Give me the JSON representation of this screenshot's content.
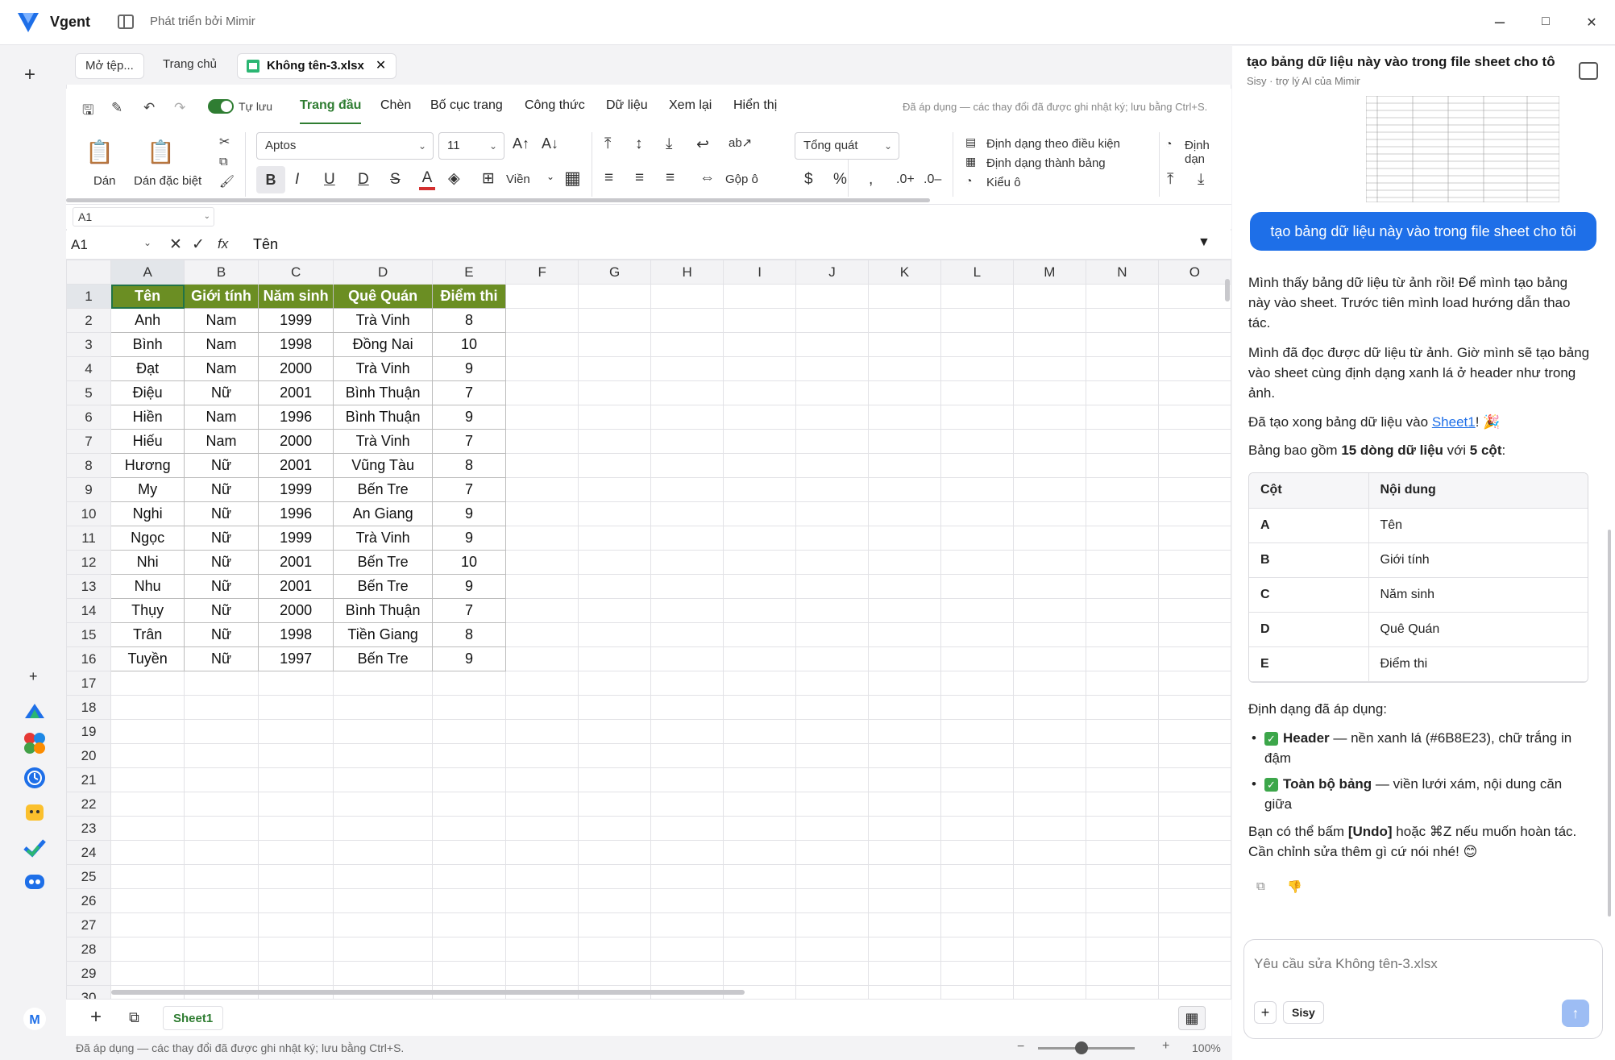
{
  "app": {
    "name": "Vgent",
    "subtitle": "Phát triển bởi Mimir",
    "window_controls": {
      "minimize": "–",
      "maximize": "□",
      "close": "✕"
    }
  },
  "file_tabs": {
    "open_label": "Mở tệp...",
    "home_label": "Trang chủ",
    "active_file": "Không tên-3.xlsx",
    "close_glyph": "✕"
  },
  "ribbon": {
    "autosave_label": "Tự lưu",
    "tabs": [
      "Trang đầu",
      "Chèn",
      "Bố cục trang",
      "Công thức",
      "Dữ liệu",
      "Xem lại",
      "Hiển thị"
    ],
    "notice": "Đã áp dụng — các thay đổi đã được ghi nhật ký; lưu bằng Ctrl+S.",
    "paste_label": "Dán",
    "paste_special_label": "Dán đặc biệt",
    "font_name": "Aptos",
    "font_size": "11",
    "border_label": "Viền",
    "merge_label": "Gộp ô",
    "number_format": "Tổng quát",
    "conditional_format": "Định dạng theo điều kiện",
    "format_as_table": "Định dạng thành bảng",
    "cell_styles": "Kiểu ô",
    "format_cut": "Định dạn",
    "bold": "B",
    "italic": "I",
    "underline": "U",
    "double_underline": "D",
    "strike": "S",
    "font_color_glyph": "A",
    "currency": "$",
    "percent": "%",
    "comma": ",",
    "inc_decimal": ".0+",
    "dec_decimal": ".0–"
  },
  "name_box_top": "A1",
  "formula_bar": {
    "cell_ref": "A1",
    "fx": "fx",
    "value": "Tên"
  },
  "grid": {
    "columns": [
      "A",
      "B",
      "C",
      "D",
      "E",
      "F",
      "G",
      "H",
      "I",
      "J",
      "K",
      "L",
      "M",
      "N",
      "O"
    ],
    "header_row": [
      "Tên",
      "Giới tính",
      "Năm sinh",
      "Quê Quán",
      "Điểm thi"
    ],
    "rows": [
      [
        "Anh",
        "Nam",
        "1999",
        "Trà Vinh",
        "8"
      ],
      [
        "Bình",
        "Nam",
        "1998",
        "Đồng Nai",
        "10"
      ],
      [
        "Đạt",
        "Nam",
        "2000",
        "Trà Vinh",
        "9"
      ],
      [
        "Điệu",
        "Nữ",
        "2001",
        "Bình Thuận",
        "7"
      ],
      [
        "Hiền",
        "Nam",
        "1996",
        "Bình Thuận",
        "9"
      ],
      [
        "Hiếu",
        "Nam",
        "2000",
        "Trà Vinh",
        "7"
      ],
      [
        "Hương",
        "Nữ",
        "2001",
        "Vũng Tàu",
        "8"
      ],
      [
        "My",
        "Nữ",
        "1999",
        "Bến Tre",
        "7"
      ],
      [
        "Nghi",
        "Nữ",
        "1996",
        "An Giang",
        "9"
      ],
      [
        "Ngọc",
        "Nữ",
        "1999",
        "Trà Vinh",
        "9"
      ],
      [
        "Nhi",
        "Nữ",
        "2001",
        "Bến Tre",
        "10"
      ],
      [
        "Nhu",
        "Nữ",
        "2001",
        "Bến Tre",
        "9"
      ],
      [
        "Thụy",
        "Nữ",
        "2000",
        "Bình Thuận",
        "7"
      ],
      [
        "Trân",
        "Nữ",
        "1998",
        "Tiền Giang",
        "8"
      ],
      [
        "Tuyền",
        "Nữ",
        "1997",
        "Bến Tre",
        "9"
      ]
    ],
    "row_numbers": [
      "1",
      "2",
      "3",
      "4",
      "5",
      "6",
      "7",
      "8",
      "9",
      "10",
      "11",
      "12",
      "13",
      "14",
      "15",
      "16",
      "17",
      "18",
      "19",
      "20",
      "21",
      "22",
      "23",
      "24",
      "25",
      "26",
      "27",
      "28",
      "29",
      "30"
    ],
    "header_color": "#6B8E23"
  },
  "sheets": {
    "active": "Sheet1"
  },
  "status_bar": {
    "text": "Đã áp dụng — các thay đổi đã được ghi nhật ký; lưu bằng Ctrl+S.",
    "zoom": "100%",
    "zoom_minus": "−",
    "zoom_plus": "+"
  },
  "chat": {
    "title": "tạo bảng dữ liệu này vào trong file sheet cho tô",
    "subtitle": "Sisy · trợ lý AI của Mimir",
    "user_message": "tạo bảng dữ liệu này vào trong file sheet cho tôi",
    "para1": "Mình thấy bảng dữ liệu từ ảnh rồi! Để mình tạo bảng này vào sheet. Trước tiên mình load hướng dẫn thao tác.",
    "para2": "Mình đã đọc được dữ liệu từ ảnh. Giờ mình sẽ tạo bảng vào sheet cùng định dạng xanh lá ở header như trong ảnh.",
    "para3_prefix": "Đã tạo xong bảng dữ liệu vào ",
    "para3_link": "Sheet1",
    "para3_suffix": "! 🎉",
    "para4_prefix": "Bảng bao gồm ",
    "para4_bold1": "15 dòng dữ liệu",
    "para4_mid": " với ",
    "para4_bold2": "5 cột",
    "para4_suffix": ":",
    "table_headers": [
      "Cột",
      "Nội dung"
    ],
    "table_rows": [
      [
        "A",
        "Tên"
      ],
      [
        "B",
        "Giới tính"
      ],
      [
        "C",
        "Năm sinh"
      ],
      [
        "D",
        "Quê Quán"
      ],
      [
        "E",
        "Điểm thi"
      ]
    ],
    "format_heading": "Định dạng đã áp dụng:",
    "bullet1_bold": "Header",
    "bullet1_text": " — nền xanh lá (#6B8E23), chữ trắng in đậm",
    "bullet2_bold": "Toàn bộ bảng",
    "bullet2_text": " — viền lưới xám, nội dung căn giữa",
    "undo_prefix": "Bạn có thể bấm ",
    "undo_bold": "[Undo]",
    "undo_suffix": " hoặc ⌘Z nếu muốn hoàn tác. Cần chỉnh sửa thêm gì cứ nói nhé! 😊",
    "input_placeholder": "Yêu cầu sửa Không tên-3.xlsx",
    "add_glyph": "+",
    "agent_label": "Sisy",
    "send_glyph": "↑"
  }
}
